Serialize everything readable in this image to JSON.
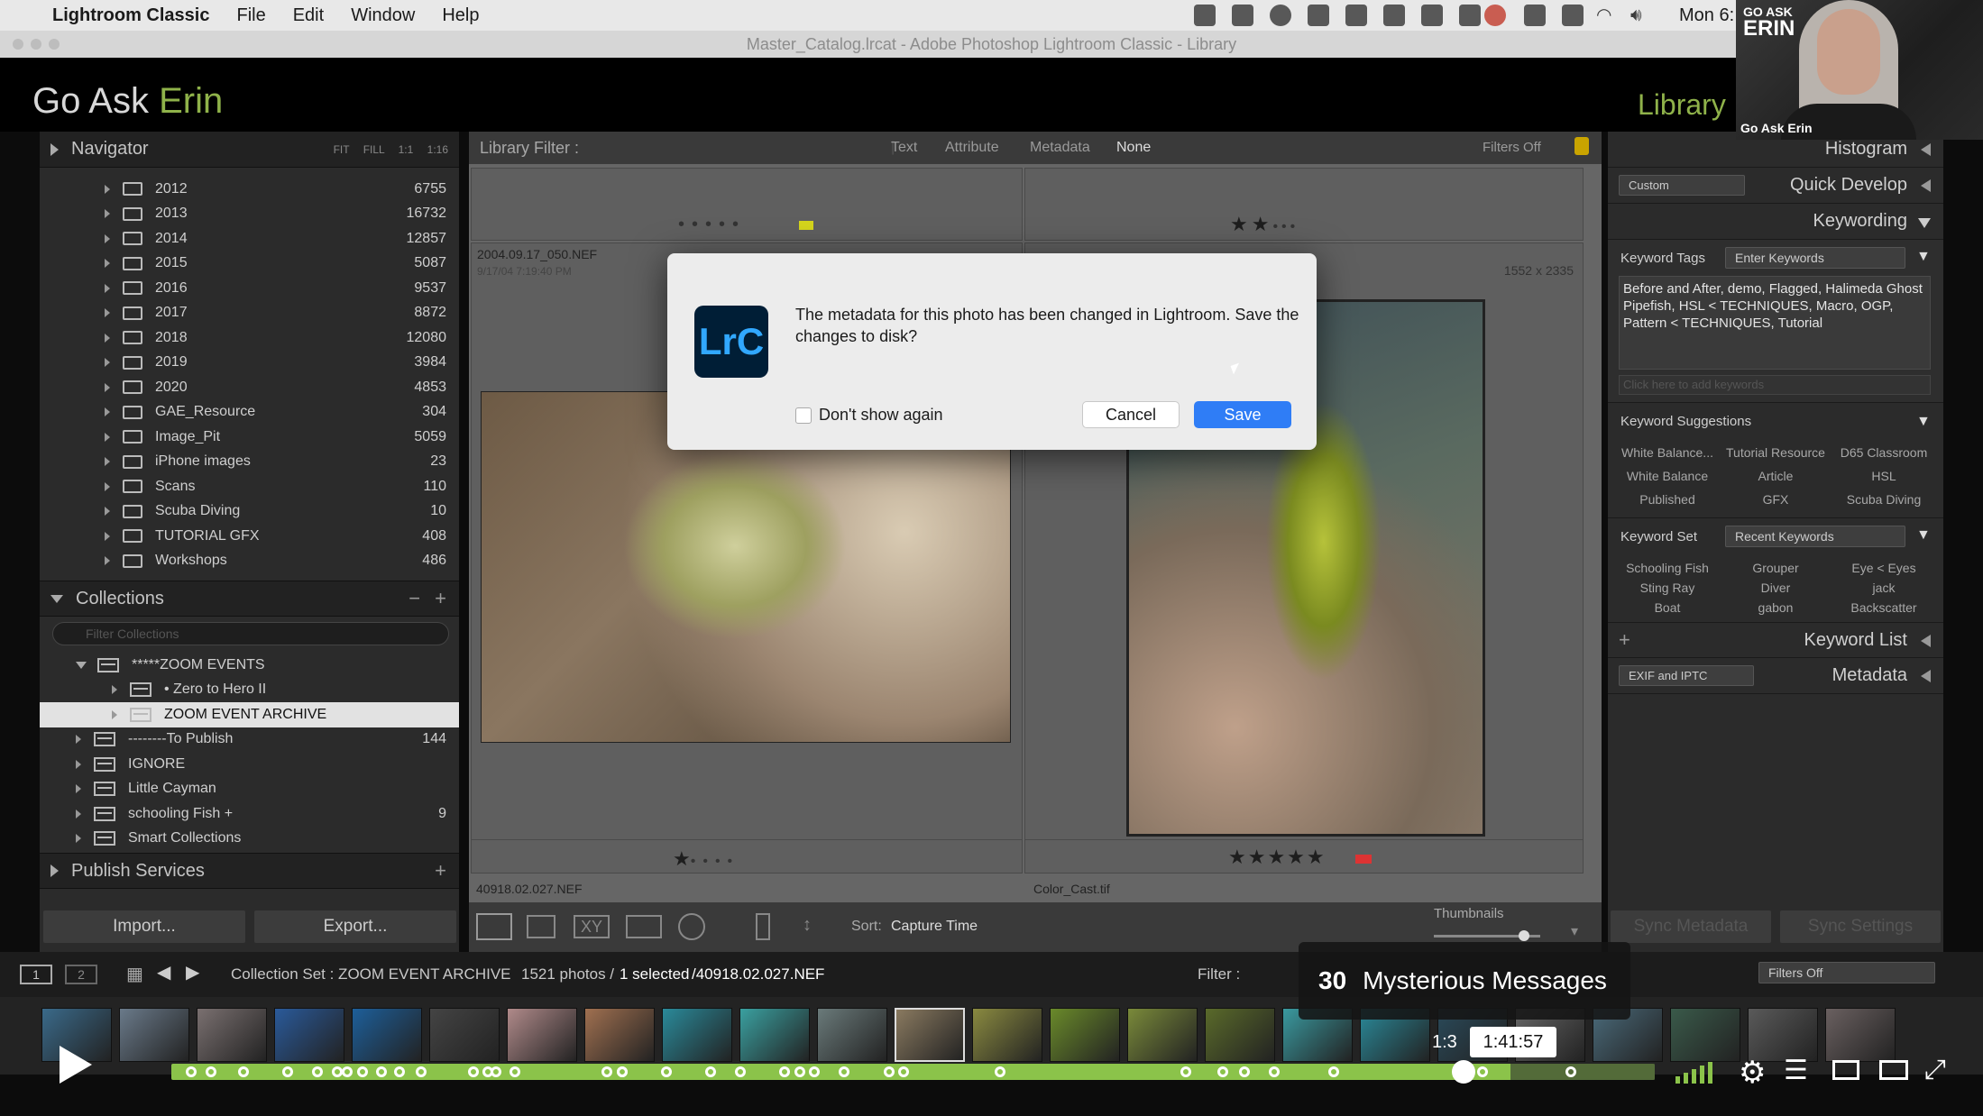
{
  "menubar": {
    "app": "Lightroom Classic",
    "items": [
      "File",
      "Edit",
      "Window",
      "Help"
    ],
    "clock": "Mon 6:"
  },
  "window_title": "Master_Catalog.lrcat - Adobe Photoshop Lightroom Classic - Library",
  "identity": {
    "part1": "Go Ask ",
    "part2": "Erin",
    "module": "Library"
  },
  "webcam": {
    "logo_line1": "GO ASK",
    "logo_line2": "ERIN",
    "name": "Go Ask Erin"
  },
  "navigator": {
    "title": "Navigator",
    "zoom": [
      "FIT",
      "FILL",
      "1:1",
      "1:16"
    ]
  },
  "folders": [
    {
      "name": "2012",
      "count": "6755"
    },
    {
      "name": "2013",
      "count": "16732"
    },
    {
      "name": "2014",
      "count": "12857"
    },
    {
      "name": "2015",
      "count": "5087"
    },
    {
      "name": "2016",
      "count": "9537"
    },
    {
      "name": "2017",
      "count": "8872"
    },
    {
      "name": "2018",
      "count": "12080"
    },
    {
      "name": "2019",
      "count": "3984"
    },
    {
      "name": "2020",
      "count": "4853"
    },
    {
      "name": "GAE_Resource",
      "count": "304"
    },
    {
      "name": "Image_Pit",
      "count": "5059"
    },
    {
      "name": "iPhone images",
      "count": "23"
    },
    {
      "name": "Scans",
      "count": "110"
    },
    {
      "name": "Scuba Diving",
      "count": "10"
    },
    {
      "name": "TUTORIAL GFX",
      "count": "408"
    },
    {
      "name": "Workshops",
      "count": "486"
    }
  ],
  "collections": {
    "title": "Collections",
    "filter_placeholder": "Filter Collections",
    "items": [
      {
        "name": "*****ZOOM EVENTS",
        "count": ""
      },
      {
        "name": "• Zero to Hero II",
        "count": ""
      },
      {
        "name": "ZOOM EVENT ARCHIVE",
        "count": ""
      },
      {
        "name": "--------To Publish",
        "count": "144"
      },
      {
        "name": "IGNORE",
        "count": ""
      },
      {
        "name": "Little Cayman",
        "count": ""
      },
      {
        "name": "schooling Fish  +",
        "count": "9"
      },
      {
        "name": "Smart Collections",
        "count": ""
      }
    ]
  },
  "publish": {
    "title": "Publish Services"
  },
  "left_buttons": {
    "import": "Import...",
    "export": "Export..."
  },
  "filterbar": {
    "title": "Library Filter :",
    "tabs": [
      "Text",
      "Attribute",
      "Metadata",
      "None"
    ],
    "status": "Filters Off"
  },
  "cells": {
    "left_top_name": "2004.09.17_050.NEF",
    "left_top_date": "9/17/04 7:19:40 PM",
    "right_top_dims": "1552 x 2335",
    "left_bottom_name": "40918.02.027.NEF",
    "right_bottom_name": "Color_Cast.tif"
  },
  "toolbar": {
    "sort_label": "Sort:",
    "sort_value": "Capture Time",
    "thumbnails": "Thumbnails"
  },
  "right_panel": {
    "histogram": "Histogram",
    "quick_develop": "Quick Develop",
    "quick_preset": "Custom",
    "keywording": "Keywording",
    "keyword_tags_label": "Keyword Tags",
    "keyword_tags_select": "Enter Keywords",
    "keywords_text": "Before and After, demo, Flagged, Halimeda Ghost Pipefish, HSL < TECHNIQUES, Macro, OGP, Pattern < TECHNIQUES, Tutorial",
    "add_keywords_placeholder": "Click here to add keywords",
    "suggestions_label": "Keyword Suggestions",
    "suggestions": [
      "White Balance...",
      "Tutorial Resource",
      "D65 Classroom",
      "White Balance",
      "Article",
      "HSL",
      "Published",
      "GFX",
      "Scuba Diving"
    ],
    "keyword_set_label": "Keyword Set",
    "keyword_set_select": "Recent Keywords",
    "keyword_set": [
      "Schooling Fish",
      "Grouper",
      "Eye < Eyes",
      "Sting Ray",
      "Diver",
      "jack",
      "Boat",
      "gabon",
      "Backscatter"
    ],
    "keyword_list": "Keyword List",
    "metadata_preset": "EXIF and IPTC",
    "metadata": "Metadata",
    "sync_metadata": "Sync Metadata",
    "sync_settings": "Sync Settings"
  },
  "filmhdr": {
    "page1": "1",
    "page2": "2",
    "source": "Collection Set : ZOOM EVENT ARCHIVE",
    "count": "1521 photos /",
    "selected": "1 selected",
    "file": "/40918.02.027.NEF",
    "filter_label": "Filter :",
    "filter_value": "Filters Off"
  },
  "dialog": {
    "icon": "LrC",
    "message": "The metadata for this photo has been changed in Lightroom. Save the changes to disk?",
    "checkbox": "Don't show again",
    "cancel": "Cancel",
    "save": "Save"
  },
  "video": {
    "chapter_num": "30",
    "chapter_title": "Mysterious Messages",
    "time_left": "1:3",
    "time": "1:41:57",
    "progress": 0.9
  }
}
